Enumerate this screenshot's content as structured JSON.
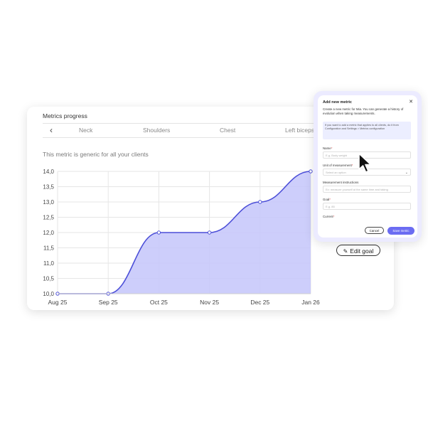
{
  "card": {
    "title": "Metrics progress",
    "back_icon": "chevron-left-icon",
    "tabs": [
      "Neck",
      "Shoulders",
      "Chest",
      "Left biceps"
    ],
    "generic_note": "This metric is generic for all your clients",
    "edit_goal_label": "Edit goal",
    "edit_goal_icon": "pencil-icon"
  },
  "chart_data": {
    "type": "area",
    "categories": [
      "Aug 25",
      "Sep 25",
      "Oct 25",
      "Nov 25",
      "Dec 25",
      "Jan 26"
    ],
    "values": [
      10.0,
      10.0,
      12.0,
      12.0,
      13.0,
      14.0
    ],
    "yticks": [
      "14,0",
      "13,5",
      "13,0",
      "12,5",
      "12,0",
      "11,5",
      "11,0",
      "10,5",
      "10,0"
    ],
    "ylim": [
      10.0,
      14.0
    ],
    "grid": true,
    "line_color": "#4c4fd8",
    "fill_color": "#c4c5fa"
  },
  "modal": {
    "title": "Add new metric",
    "close_icon": "close-icon",
    "description": "Create a new metric for Mia. You can generate a history of evolution when taking measurements.",
    "info": "If you want to add a metric that applies to all clients, do it from Configuration and Settings > Metrics configuration",
    "name_label": "Name",
    "name_placeholder": "E.g. Body weight",
    "unit_label": "Unit of measurement",
    "unit_placeholder": "Select an option",
    "instructions_label": "Measurement instructions",
    "instructions_placeholder": "Ex: measure yourself at the same time and taking",
    "goal_label": "Goal",
    "goal_placeholder": "E.g. 85",
    "current_label": "Current",
    "required_mark": "*",
    "cancel_label": "Cancel",
    "save_label": "Save metric"
  }
}
